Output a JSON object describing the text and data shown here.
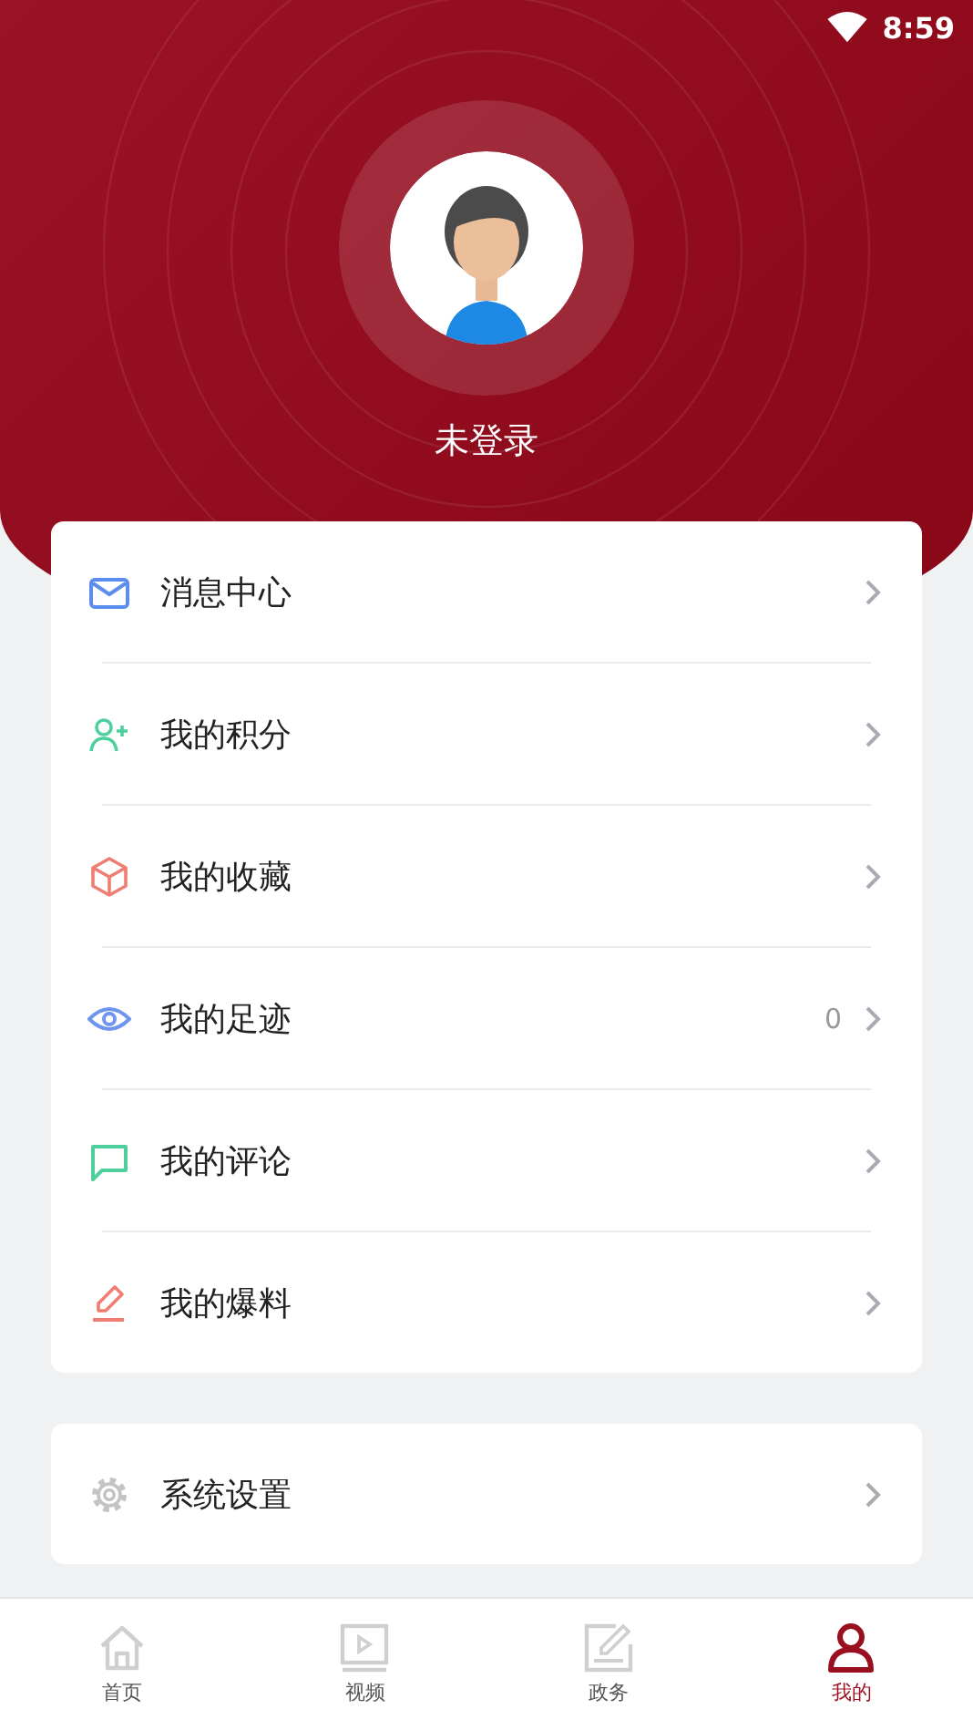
{
  "status_bar": {
    "time": "8:59"
  },
  "profile": {
    "name": "未登录"
  },
  "menu": [
    {
      "label": "消息中心"
    },
    {
      "label": "我的积分"
    },
    {
      "label": "我的收藏"
    },
    {
      "label": "我的足迹",
      "count": "0"
    },
    {
      "label": "我的评论"
    },
    {
      "label": "我的爆料"
    }
  ],
  "settings": {
    "label": "系统设置"
  },
  "tabs": [
    {
      "label": "首页",
      "selected": false
    },
    {
      "label": "视频",
      "selected": false
    },
    {
      "label": "政务",
      "selected": false
    },
    {
      "label": "我的",
      "selected": true
    }
  ]
}
